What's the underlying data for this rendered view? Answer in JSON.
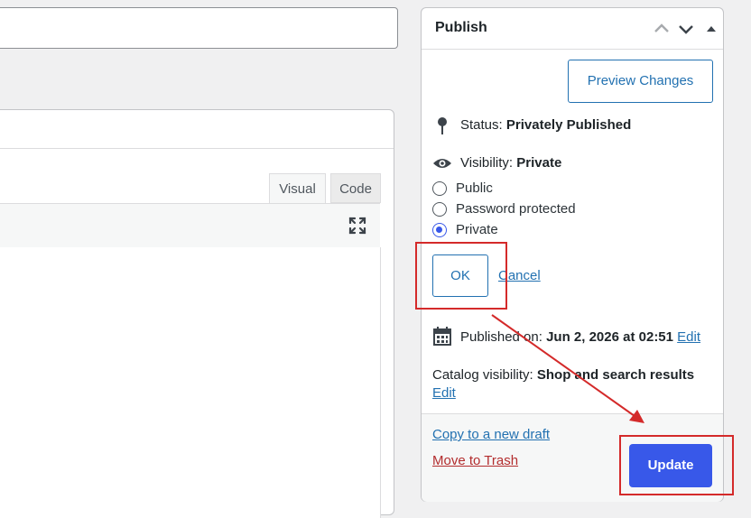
{
  "editor": {
    "tabs": [
      {
        "label": "Visual"
      },
      {
        "label": "Code"
      }
    ]
  },
  "publish": {
    "title": "Publish",
    "preview_label": "Preview Changes",
    "status_label": "Status:",
    "status_value": "Privately Published",
    "visibility_label": "Visibility:",
    "visibility_value": "Private",
    "visibility_options": [
      "Public",
      "Password protected",
      "Private"
    ],
    "selected_option": "Private",
    "ok_label": "OK",
    "cancel_label": "Cancel",
    "published_label": "Published on:",
    "published_value": "Jun 2, 2026 at 02:51",
    "published_edit": "Edit",
    "catalog_label": "Catalog visibility:",
    "catalog_value": "Shop and search results",
    "catalog_edit": "Edit",
    "copy_draft": "Copy to a new draft",
    "trash": "Move to Trash",
    "update_label": "Update"
  },
  "colors": {
    "accent": "#3858e9",
    "link": "#2271b1",
    "trash": "#b32d2e",
    "highlight": "#d42a2a"
  }
}
